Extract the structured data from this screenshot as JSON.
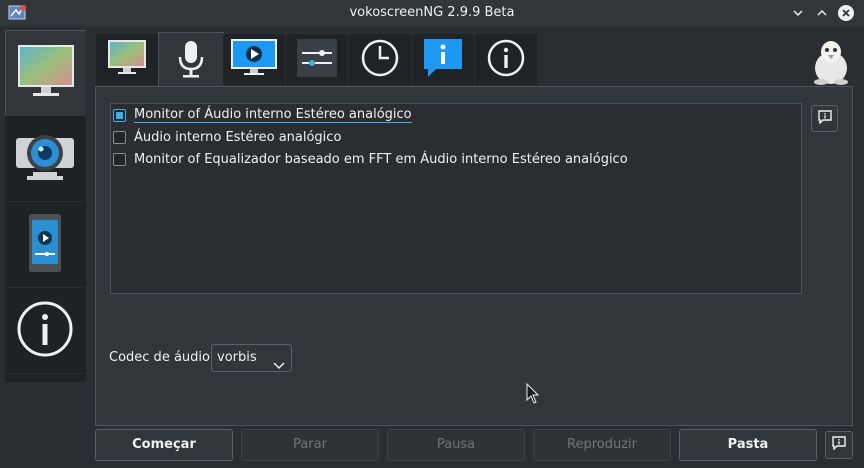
{
  "window": {
    "title": "vokoscreenNG 2.9.9 Beta"
  },
  "left_tabs": [
    {
      "name": "screencast",
      "icon": "monitor-icon",
      "active": true
    },
    {
      "name": "camera",
      "icon": "webcam-icon",
      "active": false
    },
    {
      "name": "player",
      "icon": "phone-player-icon",
      "active": false
    },
    {
      "name": "info",
      "icon": "info-icon",
      "active": false
    }
  ],
  "top_tabs": [
    {
      "name": "screen",
      "icon": "monitor-icon",
      "active": false
    },
    {
      "name": "audio",
      "icon": "microphone-icon",
      "active": true
    },
    {
      "name": "video",
      "icon": "video-play-icon",
      "active": false
    },
    {
      "name": "misc",
      "icon": "sliders-icon",
      "active": false
    },
    {
      "name": "timer",
      "icon": "clock-icon",
      "active": false
    },
    {
      "name": "hints",
      "icon": "info-bubble-icon",
      "active": false
    },
    {
      "name": "about",
      "icon": "info-circle-icon",
      "active": false
    }
  ],
  "audio": {
    "devices": [
      {
        "label": "Monitor of Áudio interno Estéreo analógico",
        "checked": true
      },
      {
        "label": "Áudio interno Estéreo analógico",
        "checked": false
      },
      {
        "label": "Monitor of Equalizador baseado em FFT em Áudio interno Estéreo analógico",
        "checked": false
      }
    ],
    "codec_label": "Codec de áudio",
    "codec_value": "vorbis"
  },
  "buttons": {
    "start": "Começar",
    "stop": "Parar",
    "pause": "Pausa",
    "play": "Reproduzir",
    "folder": "Pasta"
  },
  "colors": {
    "accent": "#3daee9",
    "background": "#31363b"
  }
}
